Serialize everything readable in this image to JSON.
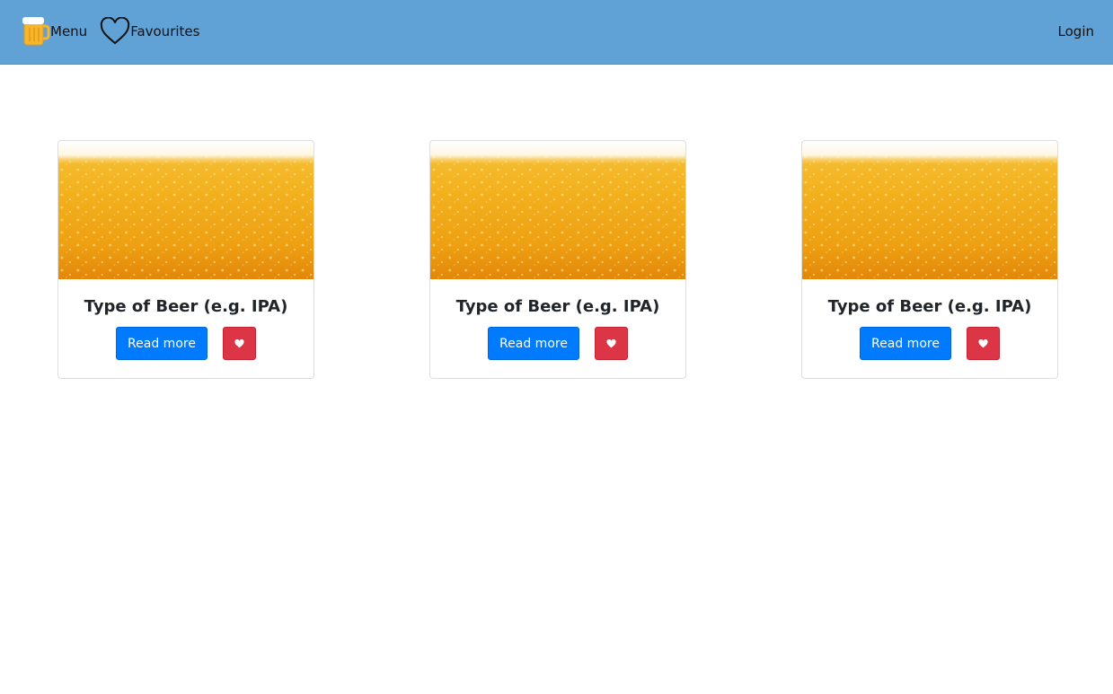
{
  "colors": {
    "navbar": "#61a2d6",
    "primary_button": "#007bff",
    "danger_button": "#dc3545",
    "beer_gold": "#f2a81a"
  },
  "nav": {
    "menu_label": "Menu",
    "menu_icon": "beer-mug-icon",
    "favourites_label": "Favourites",
    "favourites_icon": "heart-outline-icon",
    "login_label": "Login"
  },
  "cards": [
    {
      "title": "Type of Beer (e.g. IPA)",
      "read_more": "Read more",
      "fav_icon": "heart-icon",
      "image": "beer-foam-image"
    },
    {
      "title": "Type of Beer (e.g. IPA)",
      "read_more": "Read more",
      "fav_icon": "heart-icon",
      "image": "beer-foam-image"
    },
    {
      "title": "Type of Beer (e.g. IPA)",
      "read_more": "Read more",
      "fav_icon": "heart-icon",
      "image": "beer-foam-image"
    }
  ]
}
